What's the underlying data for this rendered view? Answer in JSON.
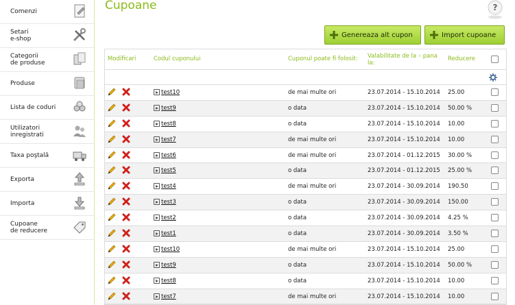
{
  "sidebar": {
    "items": [
      {
        "label": "Comenzi",
        "icon": "edit-document-icon"
      },
      {
        "label": "Setari\ne-shop",
        "icon": "tools-icon"
      },
      {
        "label": "Categorii\nde produse",
        "icon": "categories-icon"
      },
      {
        "label": "Produse",
        "icon": "products-icon"
      },
      {
        "label": "Lista de coduri",
        "icon": "codes-icon"
      },
      {
        "label": "Utilizatori\ninregistrati",
        "icon": "users-icon"
      },
      {
        "label": "Taxa poştală",
        "icon": "truck-icon"
      },
      {
        "label": "Exporta",
        "icon": "upload-icon"
      },
      {
        "label": "Importa",
        "icon": "download-icon"
      },
      {
        "label": "Cupoane\nde reducere",
        "icon": "coupon-tag-icon"
      }
    ]
  },
  "page": {
    "title": "Cupoane"
  },
  "buttons": {
    "generate": "Genereaza alt cupon",
    "import": "Import cupoane"
  },
  "table": {
    "headers": {
      "modify": "Modificari",
      "code": "Codul cuponului",
      "usage": "Cuponul poate fi folosit:",
      "validity": "Valabilitate de la – pana la:",
      "discount": "Reducere"
    },
    "rows": [
      {
        "code": "test10",
        "usage": "de mai multe ori",
        "validity": "23.07.2014 - 15.10.2014",
        "discount": "25.00"
      },
      {
        "code": "test9",
        "usage": "o data",
        "validity": "23.07.2014 - 15.10.2014",
        "discount": "50.00 %"
      },
      {
        "code": "test8",
        "usage": "o data",
        "validity": "23.07.2014 - 15.10.2014",
        "discount": "10.00"
      },
      {
        "code": "test7",
        "usage": "de mai multe ori",
        "validity": "23.07.2014 - 15.10.2014",
        "discount": "10.00"
      },
      {
        "code": "test6",
        "usage": "de mai multe ori",
        "validity": "23.07.2014 - 01.12.2015",
        "discount": "30.00 %"
      },
      {
        "code": "test5",
        "usage": "o data",
        "validity": "23.07.2014 - 01.12.2015",
        "discount": "25.00 %"
      },
      {
        "code": "test4",
        "usage": "de mai multe ori",
        "validity": "23.07.2014 - 30.09.2014",
        "discount": "190.50"
      },
      {
        "code": "test3",
        "usage": "o data",
        "validity": "23.07.2014 - 30.09.2014",
        "discount": "150.00"
      },
      {
        "code": "test2",
        "usage": "o data",
        "validity": "23.07.2014 - 30.09.2014",
        "discount": "4.25 %"
      },
      {
        "code": "test1",
        "usage": "o data",
        "validity": "23.07.2014 - 30.09.2014",
        "discount": "3.50 %"
      },
      {
        "code": "test10",
        "usage": "de mai multe ori",
        "validity": "23.07.2014 - 15.10.2014",
        "discount": "25.00"
      },
      {
        "code": "test9",
        "usage": "o data",
        "validity": "23.07.2014 - 15.10.2014",
        "discount": "50.00 %"
      },
      {
        "code": "test8",
        "usage": "o data",
        "validity": "23.07.2014 - 15.10.2014",
        "discount": "10.00"
      },
      {
        "code": "test7",
        "usage": "de mai multe ori",
        "validity": "23.07.2014 - 15.10.2014",
        "discount": "10.00"
      }
    ]
  },
  "colors": {
    "accent": "#8bbb1a",
    "button": "#a8d83c",
    "alt_row": "#f2f2f2",
    "delete": "#d0201a"
  }
}
